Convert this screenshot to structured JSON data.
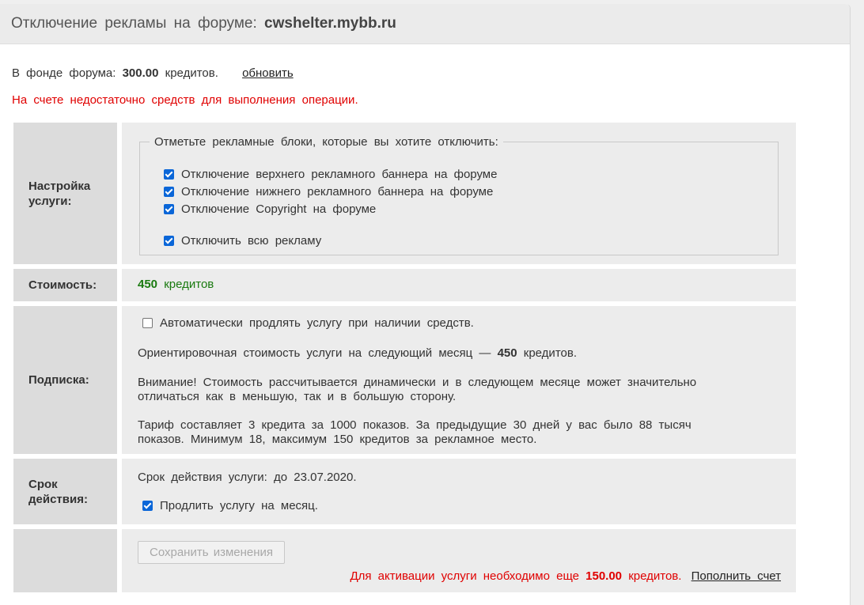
{
  "header": {
    "title_prefix": "Отключение рекламы на форуме:",
    "forum": "cwshelter.mybb.ru"
  },
  "fund": {
    "prefix": "В фонде форума:",
    "amount": "300.00",
    "suffix": "кредитов.",
    "refresh_link": "обновить"
  },
  "error_message": "На счете недостаточно средств для выполнения операции.",
  "settings": {
    "label": "Настройка услуги:",
    "legend": "Отметьте рекламные блоки, которые вы хотите отключить:",
    "options": [
      {
        "label": "Отключение верхнего рекламного баннера на форуме",
        "checked": true
      },
      {
        "label": "Отключение нижнего рекламного баннера на форуме",
        "checked": true
      },
      {
        "label": "Отключение Copyright на форуме",
        "checked": true
      },
      {
        "label": "Отключить всю рекламу",
        "checked": true
      }
    ]
  },
  "cost": {
    "label": "Стоимость:",
    "amount": "450",
    "unit": "кредитов"
  },
  "subscription": {
    "label": "Подписка:",
    "auto_renew": {
      "label": "Автоматически продлять услугу при наличии средств.",
      "checked": false
    },
    "estimate_prefix": "Ориентировочная стоимость услуги на следующий месяц —",
    "estimate_amount": "450",
    "estimate_suffix": "кредитов.",
    "warning_line1": "Внимание! Стоимость рассчитывается динамически и в следующем месяце может значительно",
    "warning_line2": "отличаться как в меньшую, так и в большую сторону.",
    "tariff_line1": "Тариф составляет 3 кредита за 1000 показов. За предыдущие 30 дней у вас было 88 тысяч",
    "tariff_line2": "показов. Минимум 18, максимум 150 кредитов за рекламное место."
  },
  "term": {
    "label_line1": "Срок",
    "label_line2": "действия:",
    "expiry": "Срок действия услуги: до 23.07.2020.",
    "extend": {
      "label": "Продлить услугу на месяц.",
      "checked": true
    }
  },
  "actions": {
    "save_button": "Сохранить изменения",
    "activate_prefix": "Для активации услуги необходимо еще",
    "activate_amount": "150.00",
    "activate_suffix": "кредитов.",
    "topup_link": "Пополнить счет"
  }
}
